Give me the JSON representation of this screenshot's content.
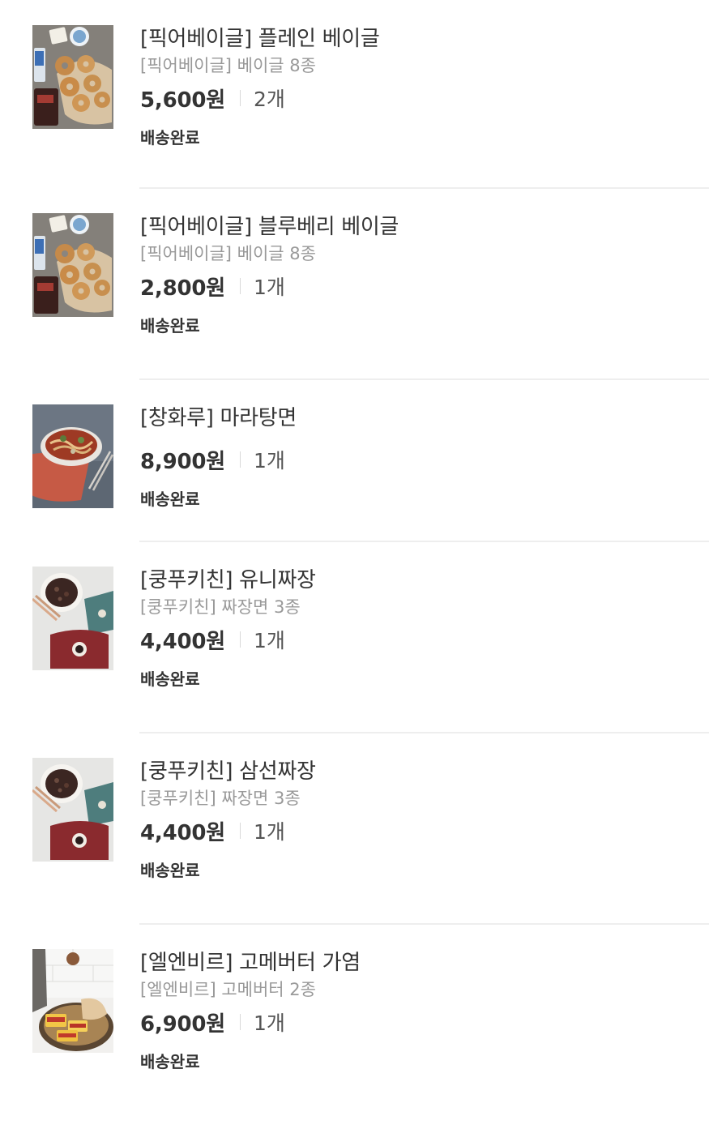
{
  "orders": [
    {
      "name": "[픽어베이글] 플레인 베이글",
      "option": "[픽어베이글] 베이글 8종",
      "price": "5,600원",
      "quantity": "2개",
      "status": "배송완료",
      "image": "bagel-photo"
    },
    {
      "name": "[픽어베이글] 블루베리 베이글",
      "option": "[픽어베이글] 베이글 8종",
      "price": "2,800원",
      "quantity": "1개",
      "status": "배송완료",
      "image": "bagel-photo"
    },
    {
      "name": "[창화루] 마라탕면",
      "option": "",
      "price": "8,900원",
      "quantity": "1개",
      "status": "배송완료",
      "image": "malatang-photo"
    },
    {
      "name": "[쿵푸키친] 유니짜장",
      "option": "[쿵푸키친] 짜장면 3종",
      "price": "4,400원",
      "quantity": "1개",
      "status": "배송완료",
      "image": "jjajang-photo"
    },
    {
      "name": "[쿵푸키친] 삼선짜장",
      "option": "[쿵푸키친] 짜장면 3종",
      "price": "4,400원",
      "quantity": "1개",
      "status": "배송완료",
      "image": "jjajang-photo"
    },
    {
      "name": "[엘엔비르] 고메버터 가염",
      "option": "[엘엔비르] 고메버터 2종",
      "price": "6,900원",
      "quantity": "1개",
      "status": "배송완료",
      "image": "butter-photo"
    }
  ]
}
